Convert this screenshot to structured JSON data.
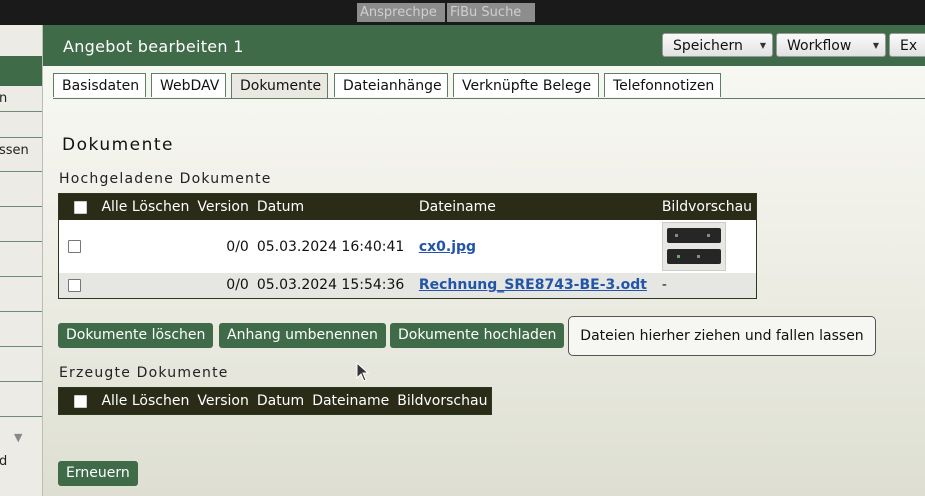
{
  "topbar": {
    "quick1": "Ansprechpe",
    "quick2": "FiBu Suche"
  },
  "sidebar": {
    "items": [
      "n",
      "ssen",
      "d"
    ]
  },
  "header": {
    "title": "Angebot bearbeiten 1",
    "buttons": {
      "save": "Speichern",
      "workflow": "Workflow",
      "more": "Ex"
    }
  },
  "tabs": [
    "Basisdaten",
    "WebDAV",
    "Dokumente",
    "Dateianhänge",
    "Verknüpfte Belege",
    "Telefonnotizen"
  ],
  "section": {
    "title": "Dokumente",
    "uploaded_heading": "Hochgeladene Dokumente",
    "generated_heading": "Erzeugte Dokumente"
  },
  "uploaded_table": {
    "columns": [
      "Alle Löschen",
      "Version",
      "Datum",
      "Dateiname",
      "Bildvorschau"
    ],
    "rows": [
      {
        "version": "0/0",
        "date": "05.03.2024 16:40:41",
        "filename": "cx0.jpg",
        "preview": ""
      },
      {
        "version": "0/0",
        "date": "05.03.2024 15:54:36",
        "filename": "Rechnung_SRE8743-BE-3.odt",
        "preview": "-"
      }
    ]
  },
  "generated_table": {
    "columns": [
      "Alle Löschen",
      "Version",
      "Datum",
      "Dateiname",
      "Bildvorschau"
    ]
  },
  "actions": {
    "delete": "Dokumente löschen",
    "rename": "Anhang umbenennen",
    "upload": "Dokumente hochladen",
    "dropzone": "Dateien hierher ziehen und fallen lassen",
    "refresh": "Erneuern"
  },
  "colors": {
    "accent": "#3f6b49",
    "table_header": "#2b2c18",
    "link": "#2255aa"
  }
}
